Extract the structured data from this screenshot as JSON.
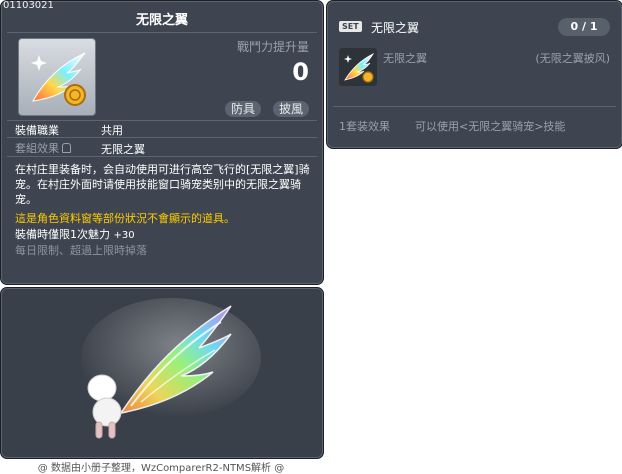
{
  "item": {
    "id": "01103021",
    "name": "无限之翼",
    "power_label": "戰鬥力提升量",
    "power_value": "0",
    "tags": [
      "防具",
      "披風"
    ],
    "job_label": "裝備職業",
    "job_value": "共用",
    "set_label": "套組效果",
    "set_value": "无限之翼",
    "description": "在村庄里装备时，会自动使用可进行高空飞行的[无限之翼]骑宠。在村庄外面时请使用技能窗口骑宠类别中的无限之翼骑宠。",
    "warning": "這是角色資料窗等部份狀況不會顯示的道具。",
    "charm_label": "裝備時僅限1次魅力",
    "charm_value": "+30",
    "limit_text": "每日限制、超過上限時掉落"
  },
  "footer": "@ 数据由小册子整理，WzComparerR2-NTMS解析 @",
  "set": {
    "badge": "SET",
    "name": "无限之翼",
    "count": "0 / 1",
    "item_name": "无限之翼",
    "item_type": "(无限之翼披风)",
    "effect_label": "1套装效果",
    "effect_text": "可以使用<无限之翼骑宠>技能"
  }
}
